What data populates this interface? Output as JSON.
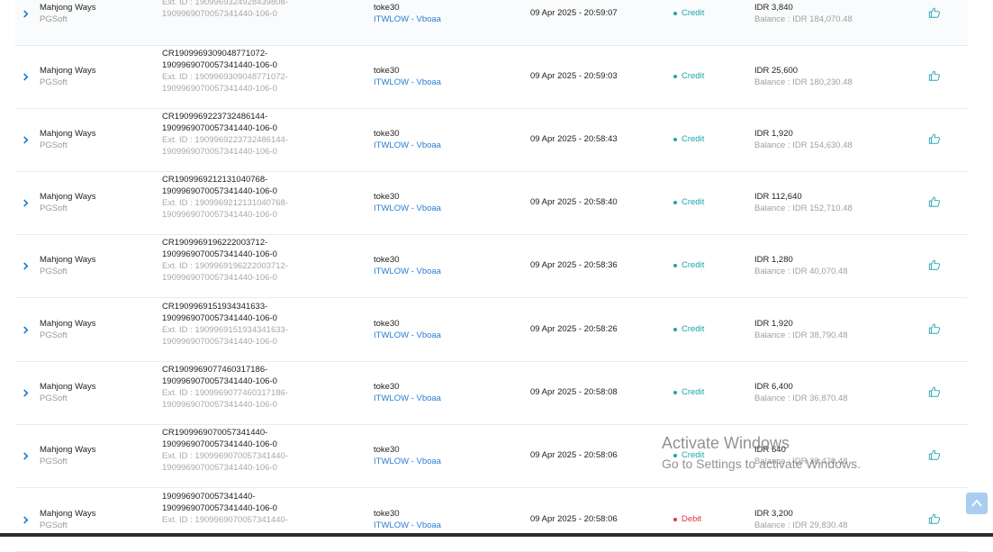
{
  "colors": {
    "credit": "#1aa7a8",
    "debit": "#e0353d",
    "link": "#2a7fd4",
    "icon": "#2aa7b3"
  },
  "icons": {
    "expand": "chevron-right-icon",
    "action": "thumbs-up-icon",
    "scroll": "arrow-up-icon"
  },
  "rows": [
    {
      "game": "Mahjong Ways",
      "provider": "PGSoft",
      "tx_line1": "",
      "tx_line2": "1909969070057341440-106-0",
      "ext_line1": "Ext. ID : 1909969324928439808-",
      "ext_line2": "1909969070057341440-106-0",
      "player": "toke30",
      "agent": "ITWLOW - Vboaa",
      "time": "09 Apr 2025 - 20:59:07",
      "type": "Credit",
      "type_color": "#1aa7a8",
      "amount": "IDR 3,840",
      "balance": "Balance : IDR 184,070.48"
    },
    {
      "game": "Mahjong Ways",
      "provider": "PGSoft",
      "tx_line1": "CR1909969309048771072-",
      "tx_line2": "1909969070057341440-106-0",
      "ext_line1": "Ext. ID : 1909969309048771072-",
      "ext_line2": "1909969070057341440-106-0",
      "player": "toke30",
      "agent": "ITWLOW - Vboaa",
      "time": "09 Apr 2025 - 20:59:03",
      "type": "Credit",
      "type_color": "#1aa7a8",
      "amount": "IDR 25,600",
      "balance": "Balance : IDR 180,230.48"
    },
    {
      "game": "Mahjong Ways",
      "provider": "PGSoft",
      "tx_line1": "CR1909969223732486144-",
      "tx_line2": "1909969070057341440-106-0",
      "ext_line1": "Ext. ID : 1909969223732486144-",
      "ext_line2": "1909969070057341440-106-0",
      "player": "toke30",
      "agent": "ITWLOW - Vboaa",
      "time": "09 Apr 2025 - 20:58:43",
      "type": "Credit",
      "type_color": "#1aa7a8",
      "amount": "IDR 1,920",
      "balance": "Balance : IDR 154,630.48"
    },
    {
      "game": "Mahjong Ways",
      "provider": "PGSoft",
      "tx_line1": "CR1909969212131040768-",
      "tx_line2": "1909969070057341440-106-0",
      "ext_line1": "Ext. ID : 1909969212131040768-",
      "ext_line2": "1909969070057341440-106-0",
      "player": "toke30",
      "agent": "ITWLOW - Vboaa",
      "time": "09 Apr 2025 - 20:58:40",
      "type": "Credit",
      "type_color": "#1aa7a8",
      "amount": "IDR 112,640",
      "balance": "Balance : IDR 152,710.48"
    },
    {
      "game": "Mahjong Ways",
      "provider": "PGSoft",
      "tx_line1": "CR1909969196222003712-",
      "tx_line2": "1909969070057341440-106-0",
      "ext_line1": "Ext. ID : 1909969196222003712-",
      "ext_line2": "1909969070057341440-106-0",
      "player": "toke30",
      "agent": "ITWLOW - Vboaa",
      "time": "09 Apr 2025 - 20:58:36",
      "type": "Credit",
      "type_color": "#1aa7a8",
      "amount": "IDR 1,280",
      "balance": "Balance : IDR 40,070.48"
    },
    {
      "game": "Mahjong Ways",
      "provider": "PGSoft",
      "tx_line1": "CR1909969151934341633-",
      "tx_line2": "1909969070057341440-106-0",
      "ext_line1": "Ext. ID : 1909969151934341633-",
      "ext_line2": "1909969070057341440-106-0",
      "player": "toke30",
      "agent": "ITWLOW - Vboaa",
      "time": "09 Apr 2025 - 20:58:26",
      "type": "Credit",
      "type_color": "#1aa7a8",
      "amount": "IDR 1,920",
      "balance": "Balance : IDR 38,790.48"
    },
    {
      "game": "Mahjong Ways",
      "provider": "PGSoft",
      "tx_line1": "CR1909969077460317186-",
      "tx_line2": "1909969070057341440-106-0",
      "ext_line1": "Ext. ID : 1909969077460317186-",
      "ext_line2": "1909969070057341440-106-0",
      "player": "toke30",
      "agent": "ITWLOW - Vboaa",
      "time": "09 Apr 2025 - 20:58:08",
      "type": "Credit",
      "type_color": "#1aa7a8",
      "amount": "IDR 6,400",
      "balance": "Balance : IDR 36,870.48"
    },
    {
      "game": "Mahjong Ways",
      "provider": "PGSoft",
      "tx_line1": "CR1909969070057341440-",
      "tx_line2": "1909969070057341440-106-0",
      "ext_line1": "Ext. ID : 1909969070057341440-",
      "ext_line2": "1909969070057341440-106-0",
      "player": "toke30",
      "agent": "ITWLOW - Vboaa",
      "time": "09 Apr 2025 - 20:58:06",
      "type": "Credit",
      "type_color": "#1aa7a8",
      "amount": "IDR 640",
      "balance": "Balance : IDR 30,470.48"
    },
    {
      "game": "Mahjong Ways",
      "provider": "PGSoft",
      "tx_line1": "1909969070057341440-",
      "tx_line2": "1909969070057341440-106-0",
      "ext_line1": "Ext. ID : 1909969070057341440-",
      "ext_line2": "",
      "player": "toke30",
      "agent": "ITWLOW - Vboaa",
      "time": "09 Apr 2025 - 20:58:06",
      "type": "Debit",
      "type_color": "#e0353d",
      "amount": "IDR 3,200",
      "balance": "Balance : IDR 29,830.48"
    }
  ],
  "watermark": {
    "line1": "Activate Windows",
    "line2": "Go to Settings to activate Windows."
  }
}
